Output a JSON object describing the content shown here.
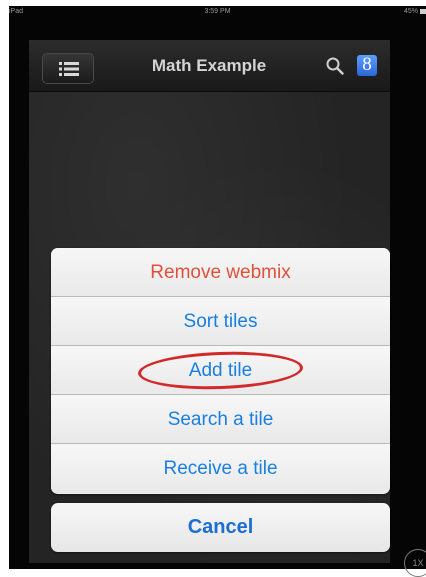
{
  "status_bar": {
    "carrier": "iPad",
    "time": "3:59 PM",
    "battery": "45%"
  },
  "navbar": {
    "title": "Math Example",
    "menu_icon": "list-icon",
    "search_icon": "search-icon",
    "google_icon": "google-icon",
    "google_letter": "8"
  },
  "action_sheet": {
    "items": [
      {
        "label": "Remove webmix",
        "style": "destructive"
      },
      {
        "label": "Sort tiles"
      },
      {
        "label": "Add tile",
        "highlighted": true
      },
      {
        "label": "Search a tile"
      },
      {
        "label": "Receive a tile"
      }
    ],
    "cancel_label": "Cancel",
    "annotation_color": "#d22a2a"
  },
  "zoom": "1X",
  "colors": {
    "action_blue": "#1a7fe0",
    "destructive_red": "#e0503a"
  }
}
